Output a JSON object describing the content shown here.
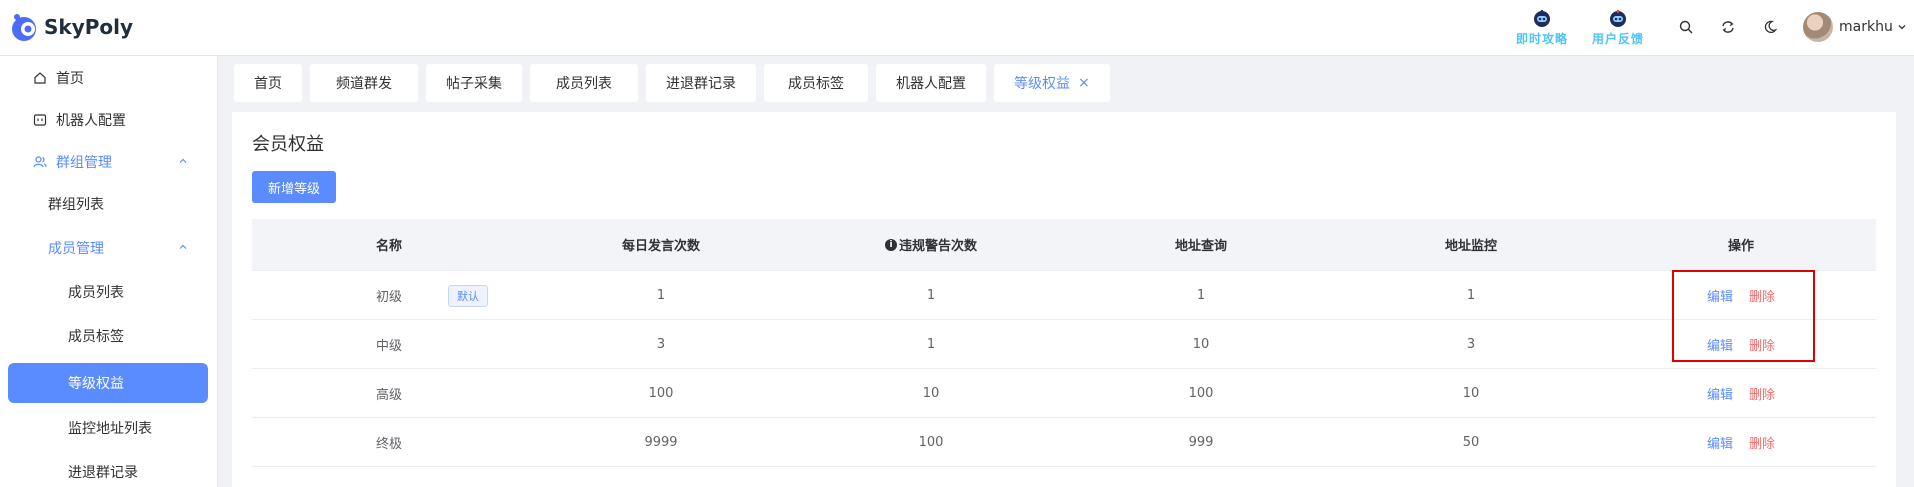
{
  "header": {
    "app_name": "SkyPoly",
    "links": [
      {
        "label": "即时攻略",
        "icon": "robot-icon"
      },
      {
        "label": "用户反馈",
        "icon": "robot-icon"
      }
    ],
    "icons": [
      "search-icon",
      "refresh-icon",
      "moon-icon"
    ],
    "username": "markhu"
  },
  "sidebar": {
    "items": [
      {
        "label": "首页",
        "icon": "home-icon"
      },
      {
        "label": "机器人配置",
        "icon": "bot-icon"
      },
      {
        "label": "群组管理",
        "icon": "users-icon"
      },
      {
        "label": "群组列表"
      },
      {
        "label": "成员管理"
      },
      {
        "label": "成员列表"
      },
      {
        "label": "成员标签"
      },
      {
        "label": "等级权益"
      },
      {
        "label": "监控地址列表"
      },
      {
        "label": "进退群记录"
      }
    ]
  },
  "tabs": [
    "首页",
    "频道群发",
    "帖子采集",
    "成员列表",
    "进退群记录",
    "成员标签",
    "机器人配置",
    "等级权益"
  ],
  "page": {
    "title": "会员权益",
    "add_button": "新增等级",
    "columns": [
      "名称",
      "每日发言次数",
      "违规警告次数",
      "地址查询",
      "地址监控",
      "操作"
    ],
    "default_tag": "默认",
    "edit_label": "编辑",
    "delete_label": "删除",
    "rows": [
      {
        "name": "初级",
        "daily": "1",
        "warn": "1",
        "query": "1",
        "monitor": "1"
      },
      {
        "name": "中级",
        "daily": "3",
        "warn": "1",
        "query": "10",
        "monitor": "3"
      },
      {
        "name": "高级",
        "daily": "100",
        "warn": "10",
        "query": "100",
        "monitor": "10"
      },
      {
        "name": "终极",
        "daily": "9999",
        "warn": "100",
        "query": "999",
        "monitor": "50"
      }
    ]
  },
  "colors": {
    "primary": "#5b8cff",
    "danger": "#f56c6c",
    "highlight": "#e00000",
    "link_cyan": "#4fc3f7"
  }
}
